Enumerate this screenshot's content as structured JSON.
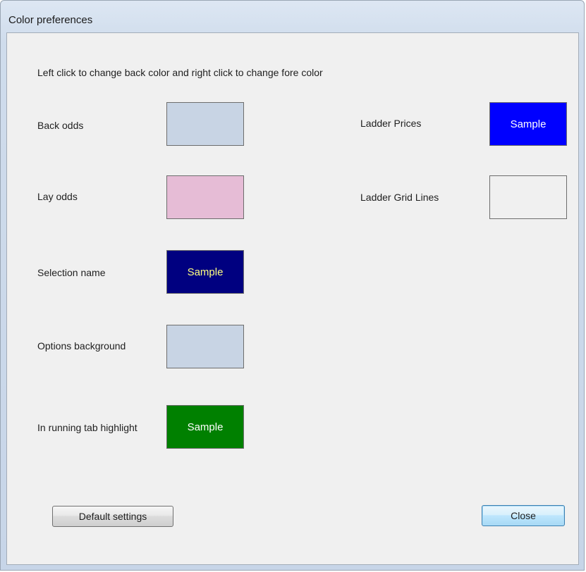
{
  "window": {
    "title": "Color preferences"
  },
  "instruction": "Left click to change back color and right click to change fore color",
  "left_prefs": [
    {
      "label": "Back odds",
      "back_color": "#c8d4e4",
      "fore_color": "#000000",
      "sample": ""
    },
    {
      "label": "Lay odds",
      "back_color": "#e6bcd6",
      "fore_color": "#000000",
      "sample": ""
    },
    {
      "label": "Selection name",
      "back_color": "#000080",
      "fore_color": "#ffff80",
      "sample": "Sample"
    },
    {
      "label": "Options background",
      "back_color": "#c8d4e4",
      "fore_color": "#000000",
      "sample": ""
    },
    {
      "label": "In running tab highlight",
      "back_color": "#008000",
      "fore_color": "#ffffff",
      "sample": "Sample"
    }
  ],
  "right_prefs": [
    {
      "label": "Ladder Prices",
      "back_color": "#0000ff",
      "fore_color": "#ffffff",
      "sample": "Sample"
    },
    {
      "label": "Ladder Grid Lines",
      "back_color": "#f0f0f0",
      "fore_color": "#000000",
      "sample": ""
    }
  ],
  "buttons": {
    "default_settings": "Default settings",
    "close": "Close"
  }
}
